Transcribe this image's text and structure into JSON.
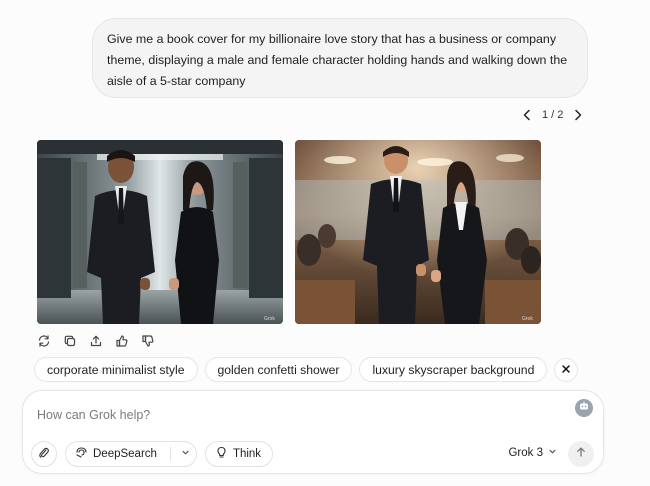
{
  "conversation": {
    "user_message": "Give me a book cover for my billionaire love story that has a business or company theme, displaying a male and female character holding hands and walking down the aisle of a 5-star company",
    "pager": {
      "current": "1 / 2"
    },
    "images": [
      {
        "watermark": "Grok"
      },
      {
        "watermark": "Grok"
      }
    ],
    "actions": [
      "regenerate-icon",
      "copy-icon",
      "share-icon",
      "thumbs-up-icon",
      "thumbs-down-icon"
    ],
    "suggestions": [
      "corporate minimalist style",
      "golden confetti shower",
      "luxury skyscraper background"
    ]
  },
  "composer": {
    "placeholder": "How can Grok help?",
    "deepsearch_label": "DeepSearch",
    "think_label": "Think",
    "model_label": "Grok 3"
  },
  "colors": {
    "background": "#fcfcfc",
    "bubble": "#f4f4f4",
    "border": "#e6e6e6"
  }
}
